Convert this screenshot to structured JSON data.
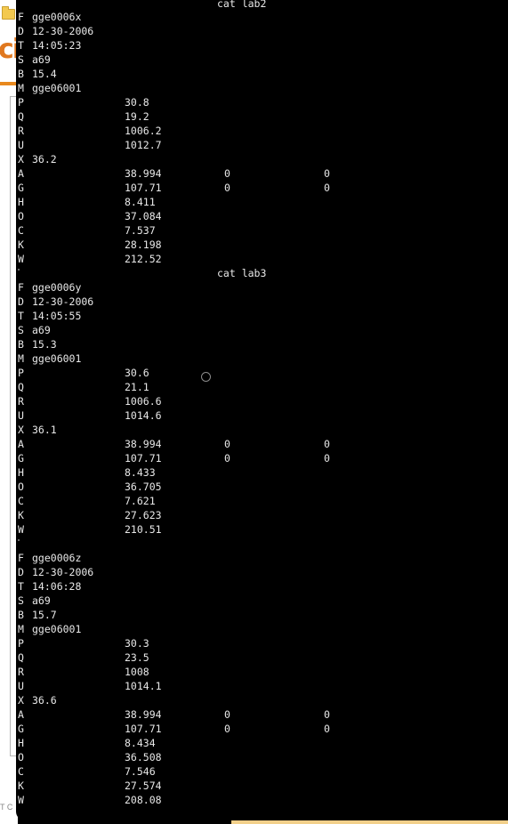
{
  "background_window": {
    "brand_text": "ci",
    "footer_text": "T C"
  },
  "terminal": {
    "sections": [
      {
        "title": "cat lab2",
        "rows": [
          {
            "k": "F",
            "v1": "gge0006x"
          },
          {
            "k": "D",
            "v1": "12-30-2006"
          },
          {
            "k": "T",
            "v1": "14:05:23"
          },
          {
            "k": "S",
            "v1": "a69"
          },
          {
            "k": "B",
            "v1": "15.4"
          },
          {
            "k": "M",
            "v1": "gge06001"
          },
          {
            "k": "P",
            "v2": "30.8"
          },
          {
            "k": "Q",
            "v2": "19.2"
          },
          {
            "k": "R",
            "v2": "1006.2"
          },
          {
            "k": "U",
            "v2": "1012.7"
          },
          {
            "k": "X",
            "v1": "36.2"
          },
          {
            "k": "A",
            "v2": "38.994",
            "v3": "0",
            "v4": "0"
          },
          {
            "k": "G",
            "v2": "107.71",
            "v3": "0",
            "v4": "0"
          },
          {
            "k": "H",
            "v2": "8.411"
          },
          {
            "k": "O",
            "v2": "37.084"
          },
          {
            "k": "C",
            "v2": "7.537"
          },
          {
            "k": "K",
            "v2": "28.198"
          },
          {
            "k": "W",
            "v2": "212.52"
          }
        ]
      },
      {
        "title": "cat lab3",
        "rows": [
          {
            "k": "F",
            "v1": "gge0006y"
          },
          {
            "k": "D",
            "v1": "12-30-2006"
          },
          {
            "k": "T",
            "v1": "14:05:55"
          },
          {
            "k": "S",
            "v1": "a69"
          },
          {
            "k": "B",
            "v1": "15.3"
          },
          {
            "k": "M",
            "v1": "gge06001"
          },
          {
            "k": "P",
            "v2": "30.6"
          },
          {
            "k": "Q",
            "v2": "21.1"
          },
          {
            "k": "R",
            "v2": "1006.6"
          },
          {
            "k": "U",
            "v2": "1014.6"
          },
          {
            "k": "X",
            "v1": "36.1"
          },
          {
            "k": "A",
            "v2": "38.994",
            "v3": "0",
            "v4": "0"
          },
          {
            "k": "G",
            "v2": "107.71",
            "v3": "0",
            "v4": "0"
          },
          {
            "k": "H",
            "v2": "8.433"
          },
          {
            "k": "O",
            "v2": "36.705"
          },
          {
            "k": "C",
            "v2": "7.621"
          },
          {
            "k": "K",
            "v2": "27.623"
          },
          {
            "k": "W",
            "v2": "210.51"
          }
        ]
      },
      {
        "title": "",
        "rows": [
          {
            "k": "F",
            "v1": "gge0006z"
          },
          {
            "k": "D",
            "v1": "12-30-2006"
          },
          {
            "k": "T",
            "v1": "14:06:28"
          },
          {
            "k": "S",
            "v1": "a69"
          },
          {
            "k": "B",
            "v1": "15.7"
          },
          {
            "k": "M",
            "v1": "gge06001"
          },
          {
            "k": "P",
            "v2": "30.3"
          },
          {
            "k": "Q",
            "v2": "23.5"
          },
          {
            "k": "R",
            "v2": "1008"
          },
          {
            "k": "U",
            "v2": "1014.1"
          },
          {
            "k": "X",
            "v1": "36.6"
          },
          {
            "k": "A",
            "v2": "38.994",
            "v3": "0",
            "v4": "0"
          },
          {
            "k": "G",
            "v2": "107.71",
            "v3": "0",
            "v4": "0"
          },
          {
            "k": "H",
            "v2": "8.434"
          },
          {
            "k": "O",
            "v2": "36.508"
          },
          {
            "k": "C",
            "v2": "7.546"
          },
          {
            "k": "K",
            "v2": "27.574"
          },
          {
            "k": "W",
            "v2": "208.08"
          }
        ]
      }
    ]
  }
}
